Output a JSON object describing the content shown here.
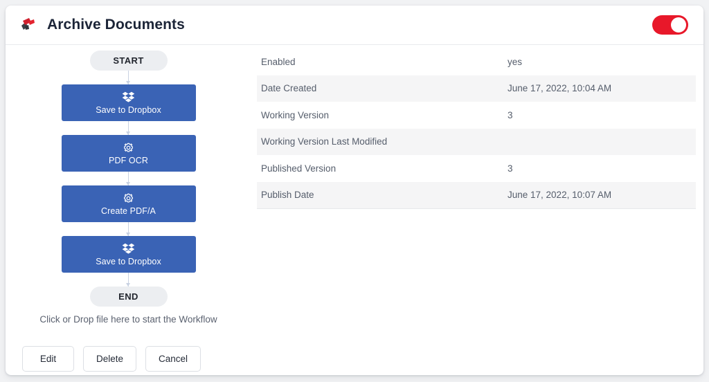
{
  "header": {
    "logo_icon": "app-logo-icon",
    "title": "Archive Documents",
    "toggle": {
      "name": "workflow-enabled-toggle",
      "state": "on",
      "color": "#e8182a"
    }
  },
  "flow": {
    "start_label": "START",
    "end_label": "END",
    "node_color": "#3a63b5",
    "nodes": [
      {
        "icon": "dropbox-icon",
        "label": "Save to Dropbox"
      },
      {
        "icon": "gear-icon",
        "label": "PDF OCR"
      },
      {
        "icon": "gear-icon",
        "label": "Create PDF/A"
      },
      {
        "icon": "dropbox-icon",
        "label": "Save to Dropbox"
      }
    ],
    "drop_hint": "Click or Drop file here to start the Workflow"
  },
  "buttons": [
    {
      "name": "edit-button",
      "label": "Edit"
    },
    {
      "name": "delete-button",
      "label": "Delete"
    },
    {
      "name": "cancel-button",
      "label": "Cancel"
    }
  ],
  "properties": [
    {
      "key": "Enabled",
      "value": "yes"
    },
    {
      "key": "Date Created",
      "value": "June 17, 2022, 10:04 AM"
    },
    {
      "key": "Working Version",
      "value": "3"
    },
    {
      "key": "Working Version Last Modified",
      "value": ""
    },
    {
      "key": "Published Version",
      "value": "3"
    },
    {
      "key": "Publish Date",
      "value": "June 17, 2022, 10:07 AM"
    }
  ]
}
